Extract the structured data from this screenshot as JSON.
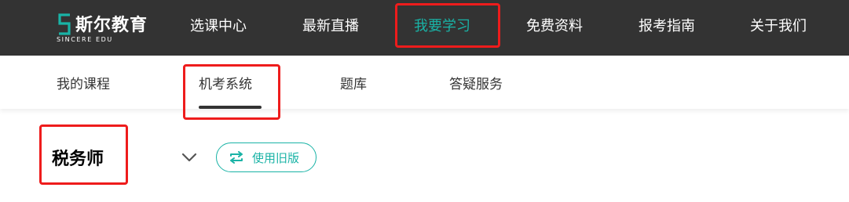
{
  "brand": {
    "name": "斯尔教育",
    "subtitle": "SINCERE EDU",
    "logo_icon": "s-logo-mark"
  },
  "top_nav": [
    {
      "label": "选课中心"
    },
    {
      "label": "最新直播"
    },
    {
      "label": "我要学习",
      "active": true
    },
    {
      "label": "免费资料"
    },
    {
      "label": "报考指南"
    },
    {
      "label": "关于我们"
    }
  ],
  "sub_nav": [
    {
      "label": "我的课程"
    },
    {
      "label": "机考系统",
      "active": true
    },
    {
      "label": "题库"
    },
    {
      "label": "答疑服务"
    }
  ],
  "exam": {
    "selected": "税务师",
    "dropdown_icon": "chevron-down-icon",
    "old_version_label": "使用旧版",
    "old_version_icon": "swap-arrows-icon"
  },
  "colors": {
    "topbar_bg": "#333333",
    "accent": "#19b3a6",
    "highlight_box": "#ee1c1c"
  }
}
